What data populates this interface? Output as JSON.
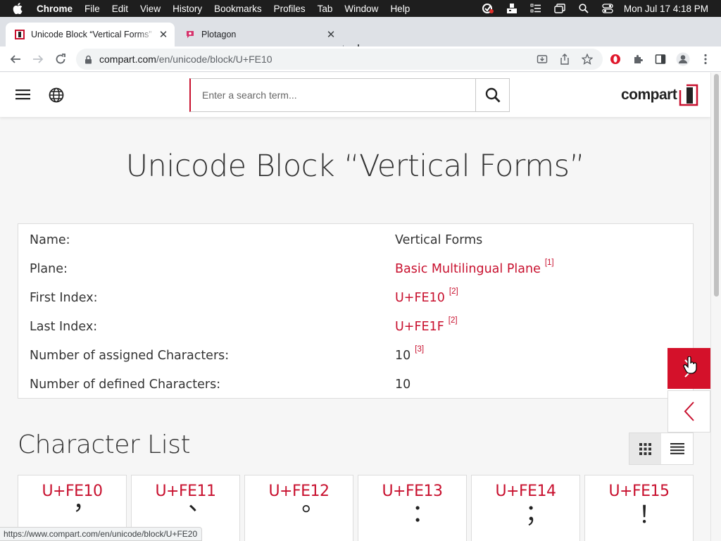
{
  "menubar": {
    "app": "Chrome",
    "items": [
      "File",
      "Edit",
      "View",
      "History",
      "Bookmarks",
      "Profiles",
      "Tab",
      "Window",
      "Help"
    ],
    "clock": "Mon Jul 17  4:18 PM"
  },
  "tabs": [
    {
      "title": "Unicode Block “Vertical Forms”",
      "active": true
    },
    {
      "title": "Plotagon",
      "active": false
    }
  ],
  "omnibox": {
    "host": "compart.com",
    "path": "/en/unicode/block/U+FE10"
  },
  "site": {
    "search_placeholder": "Enter a search term...",
    "logo_text": "compart"
  },
  "page": {
    "title": "Unicode Block “Vertical Forms”",
    "info": [
      {
        "label": "Name:",
        "value": "Vertical Forms",
        "link": false,
        "ref": ""
      },
      {
        "label": "Plane:",
        "value": "Basic Multilingual Plane",
        "link": true,
        "ref": "[1]"
      },
      {
        "label": "First Index:",
        "value": "U+FE10",
        "link": true,
        "ref": "[2]"
      },
      {
        "label": "Last Index:",
        "value": "U+FE1F",
        "link": true,
        "ref": "[2]"
      },
      {
        "label": "Number of assigned Characters:",
        "value": "10",
        "link": false,
        "ref": "[3]"
      },
      {
        "label": "Number of defined Characters:",
        "value": "10",
        "link": false,
        "ref": ""
      }
    ],
    "section_title": "Character List",
    "characters": [
      {
        "code": "U+FE10",
        "glyph": "︐"
      },
      {
        "code": "U+FE11",
        "glyph": "︑"
      },
      {
        "code": "U+FE12",
        "glyph": "︒"
      },
      {
        "code": "U+FE13",
        "glyph": "︓"
      },
      {
        "code": "U+FE14",
        "glyph": "︔"
      },
      {
        "code": "U+FE15",
        "glyph": "︕"
      }
    ]
  },
  "status_url": "https://www.compart.com/en/unicode/block/U+FE20",
  "colors": {
    "accent": "#c8102e",
    "side_button": "#d4112a"
  }
}
